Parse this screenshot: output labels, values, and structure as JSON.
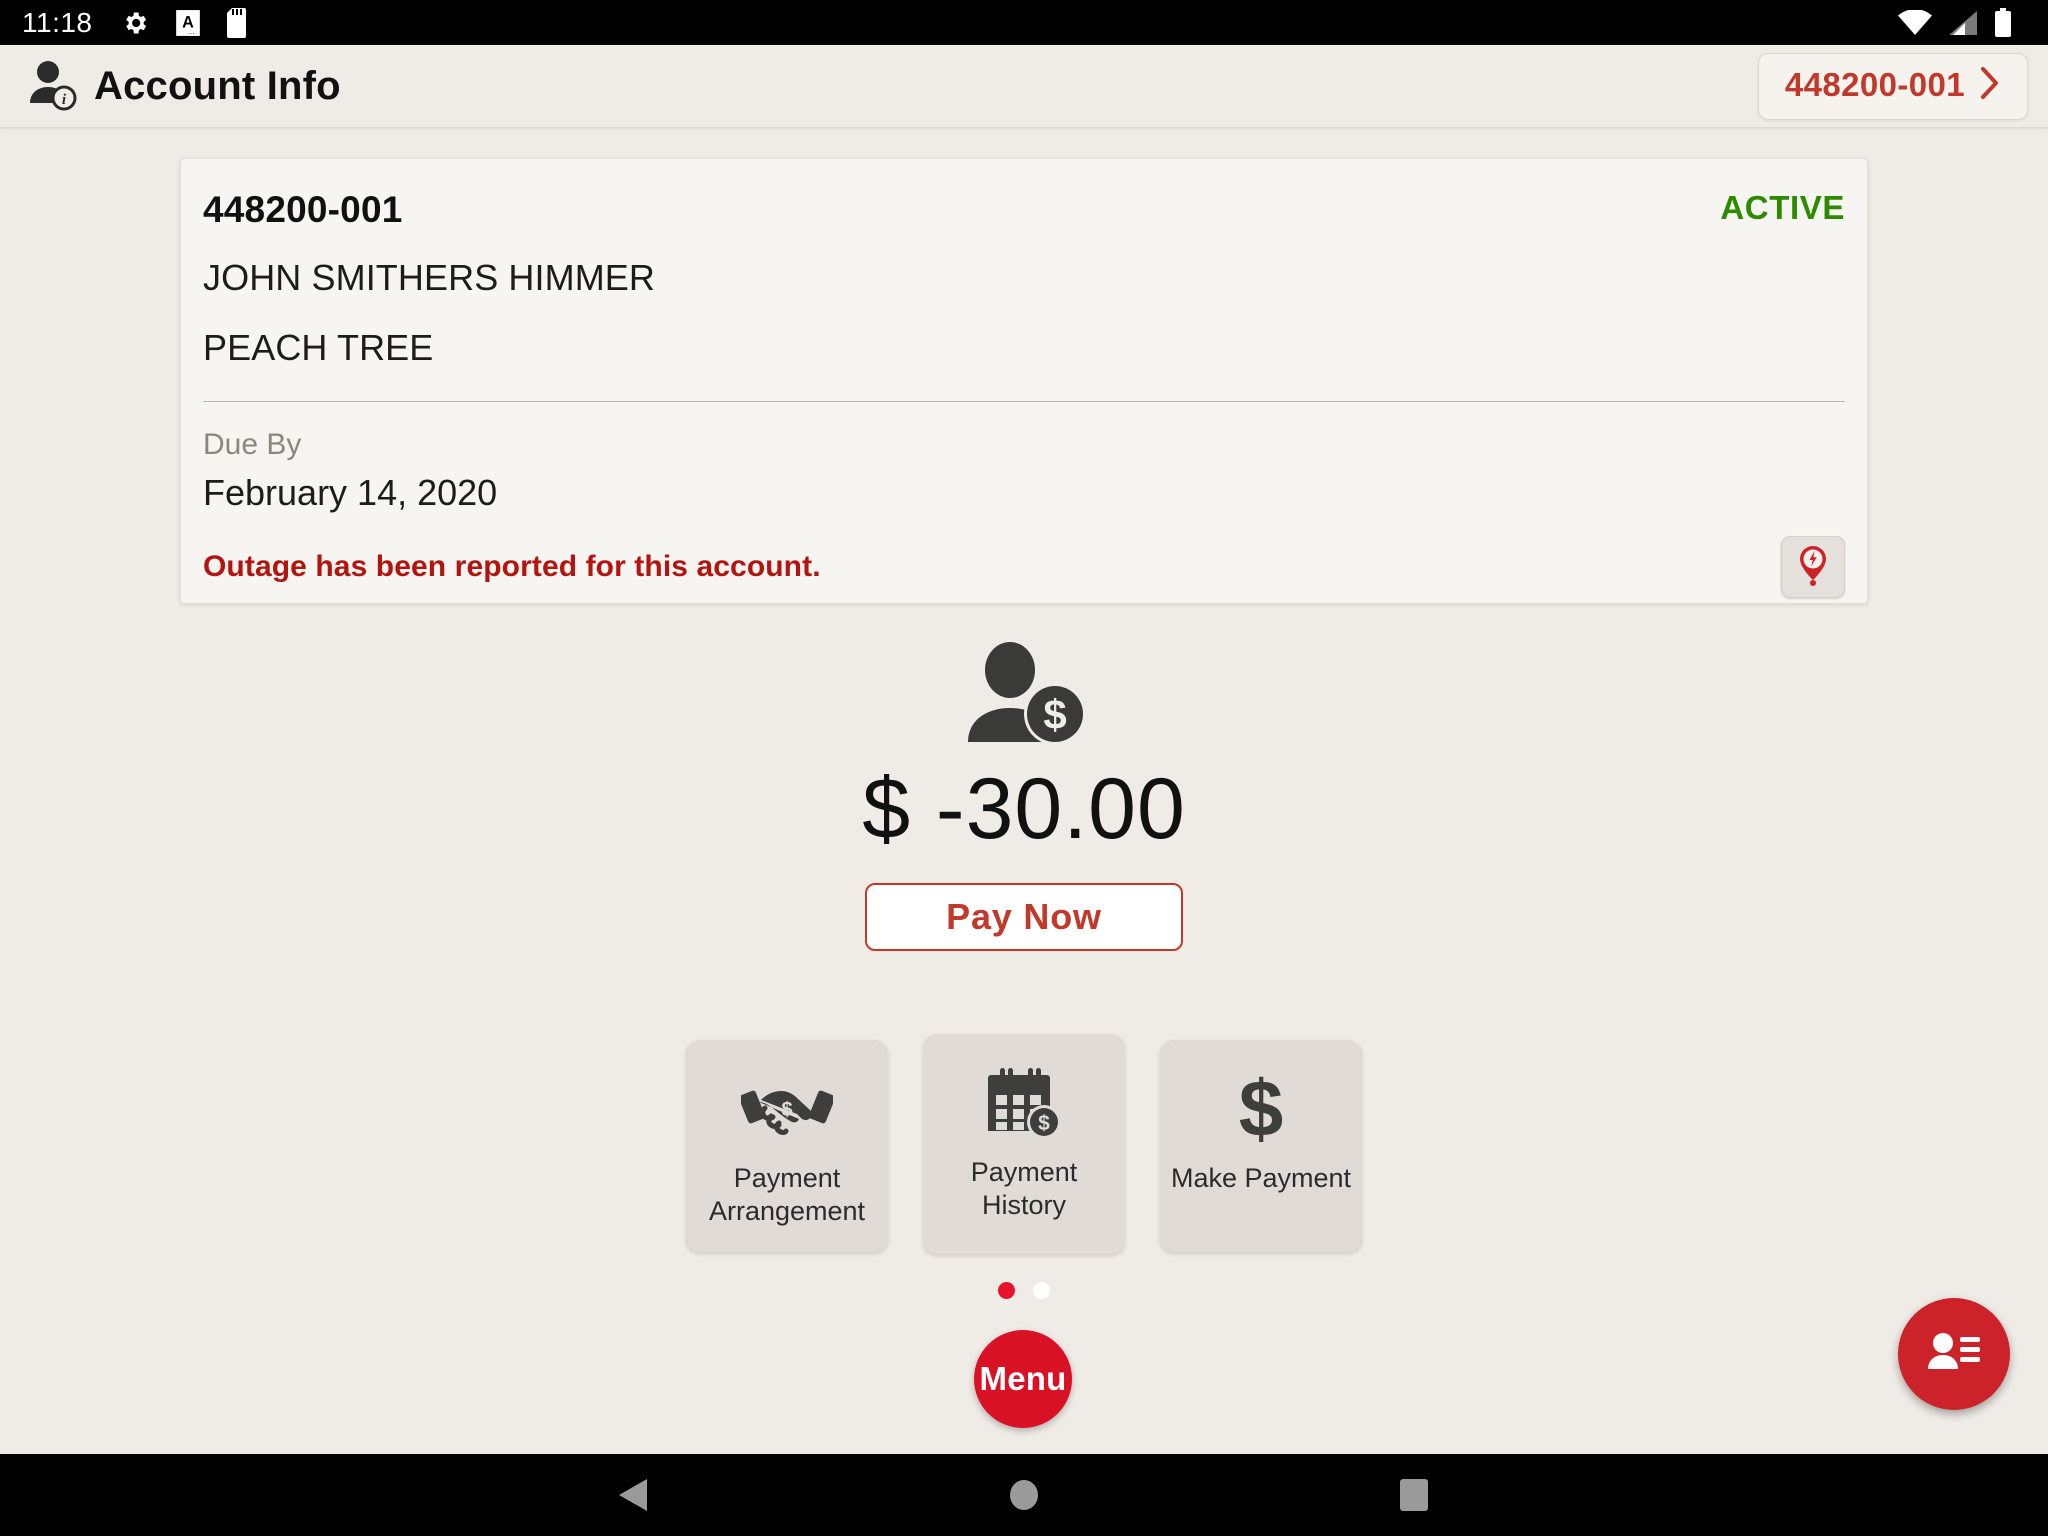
{
  "status_bar": {
    "clock": "11:18",
    "left_icons": [
      "gear-icon",
      "a-font-icon",
      "sd-card-icon"
    ],
    "right_icons": [
      "wifi-icon",
      "cell-signal-icon",
      "battery-icon"
    ]
  },
  "app_bar": {
    "icon": "account-info-icon",
    "title": "Account Info",
    "account_chip": {
      "label": "448200-001",
      "chevron": "chevron-right-icon"
    }
  },
  "account_card": {
    "account_number": "448200-001",
    "status": "ACTIVE",
    "status_color": "#2e8b00",
    "customer_name": "JOHN SMITHERS HIMMER",
    "address": "PEACH TREE",
    "due_by_label": "Due By",
    "due_by_date": "February 14, 2020",
    "outage_message": "Outage has been reported for this account.",
    "outage_color": "#b3140f",
    "outage_button_icon": "outage-pin-icon"
  },
  "balance": {
    "icon": "person-dollar-icon",
    "amount": "$ -30.00",
    "pay_now_label": "Pay Now",
    "accent_color": "#c0392b"
  },
  "action_tiles": [
    {
      "icon": "handshake-dollar-icon",
      "label": "Payment\nArrangement",
      "line1": "Payment",
      "line2": "Arrangement"
    },
    {
      "icon": "calendar-dollar-icon",
      "label": "Payment\nHistory",
      "line1": "Payment",
      "line2": "History"
    },
    {
      "icon": "dollar-sign-icon",
      "label": "Make Payment",
      "line1": "Make Payment",
      "line2": ""
    }
  ],
  "pager": {
    "total": 2,
    "active_index": 0,
    "active_color": "#e8122a",
    "inactive_color": "#ffffff"
  },
  "menu_fab": {
    "label": "Menu",
    "color": "#d81124"
  },
  "contacts_fab": {
    "icon": "contact-list-icon",
    "color": "#cc2229"
  },
  "navigation_bar": {
    "buttons": [
      "back-triangle-icon",
      "home-circle-icon",
      "recents-square-icon"
    ]
  }
}
